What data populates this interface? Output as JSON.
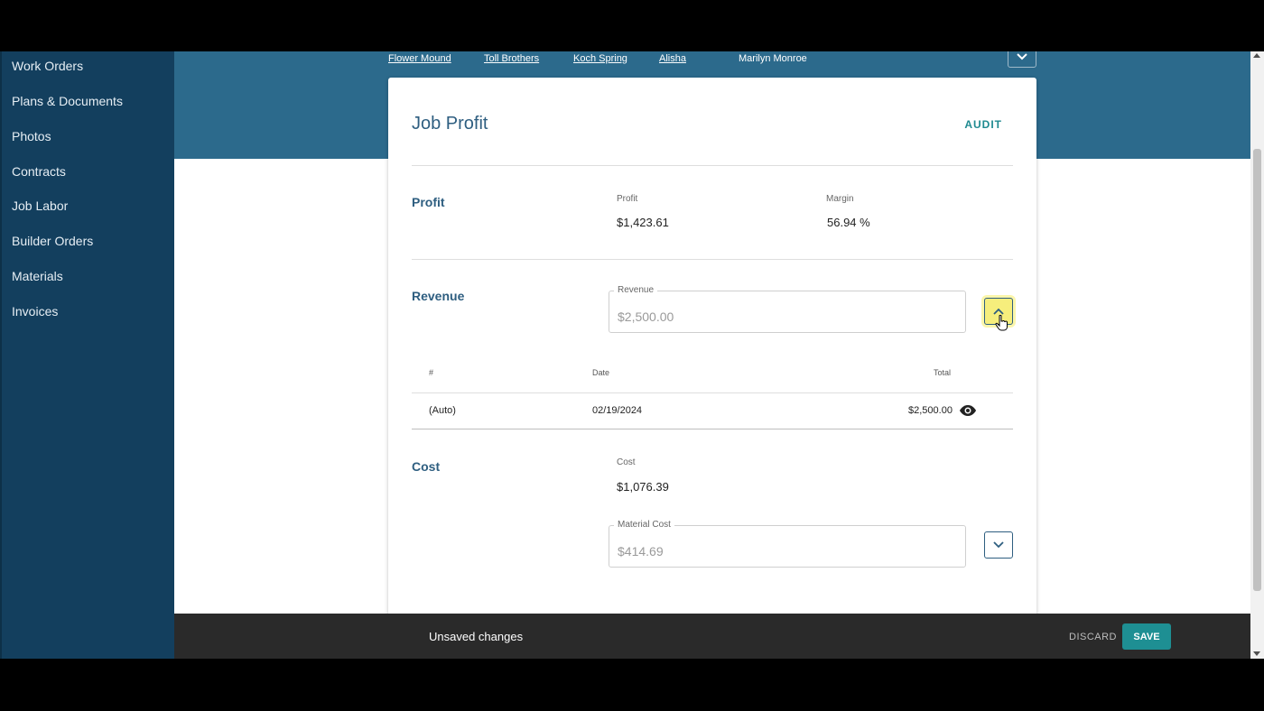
{
  "sidebar": {
    "items": [
      {
        "label": "Work Orders"
      },
      {
        "label": "Plans & Documents"
      },
      {
        "label": "Photos"
      },
      {
        "label": "Contracts"
      },
      {
        "label": "Job Labor"
      },
      {
        "label": "Builder Orders"
      },
      {
        "label": "Materials"
      },
      {
        "label": "Invoices"
      }
    ]
  },
  "header": {
    "breadcrumbs": [
      "Flower Mound",
      "Toll Brothers",
      "Koch Spring",
      "Alisha"
    ],
    "user_name": "Marilyn Monroe"
  },
  "card": {
    "title": "Job Profit",
    "audit_label": "AUDIT",
    "profit": {
      "section_title": "Profit",
      "profit_label": "Profit",
      "profit_value": "$1,423.61",
      "margin_label": "Margin",
      "margin_value": "56.94 %"
    },
    "revenue": {
      "section_title": "Revenue",
      "field_label": "Revenue",
      "field_value": "$2,500.00",
      "table": {
        "headers": [
          "#",
          "Date",
          "Total"
        ],
        "rows": [
          {
            "num": "(Auto)",
            "date": "02/19/2024",
            "total": "$2,500.00"
          }
        ]
      }
    },
    "cost": {
      "section_title": "Cost",
      "cost_label": "Cost",
      "cost_value": "$1,076.39",
      "material_label": "Material Cost",
      "material_value": "$414.69"
    }
  },
  "footer": {
    "status": "Unsaved changes",
    "discard_label": "DISCARD",
    "save_label": "SAVE"
  },
  "colors": {
    "sidebar_bg": "#133f5e",
    "banner_bg": "#2c6a8c",
    "accent": "#1e8f93",
    "highlight": "#f6ee7c"
  }
}
